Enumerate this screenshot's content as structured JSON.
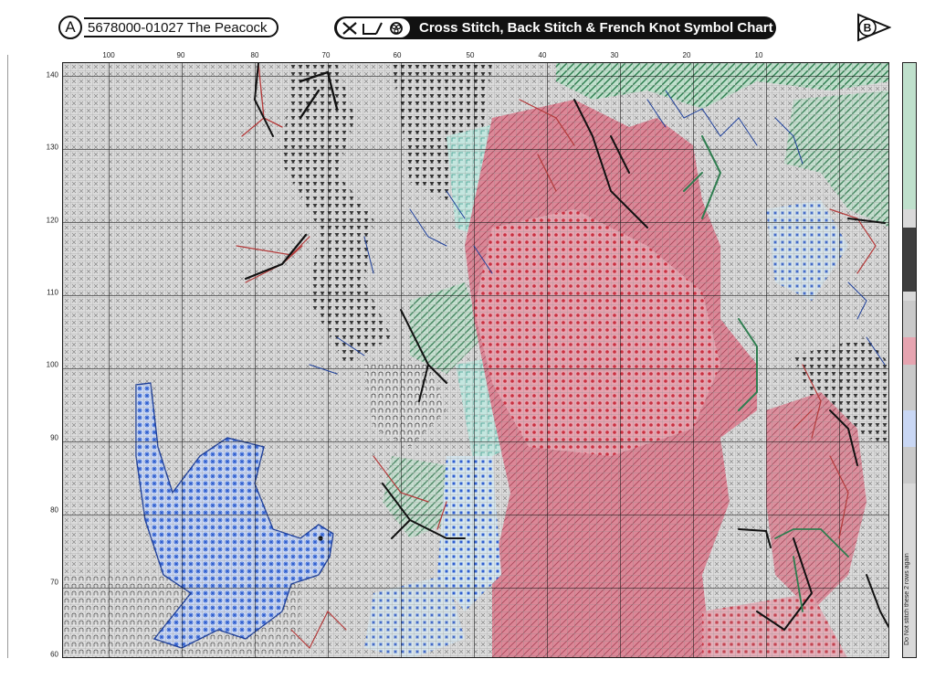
{
  "header": {
    "section_letter": "A",
    "pattern_title": "5678000-01027 The Peacock",
    "chart_title": "Cross Stitch, Back Stitch & French Knot Symbol Chart",
    "next_section_letter": "B"
  },
  "axes": {
    "columns": [
      "100",
      "90",
      "80",
      "70",
      "60",
      "50",
      "40",
      "30",
      "20",
      "10"
    ],
    "rows": [
      "140",
      "130",
      "120",
      "110",
      "100",
      "90",
      "80",
      "70",
      "60"
    ]
  },
  "side_note": "Do Not stitch these 2 rows again",
  "colors": {
    "grid_gray": "#d9d9d9",
    "floss_pink": "#e2889a",
    "floss_red": "#c92f3f",
    "floss_green": "#2e7d4f",
    "floss_blue": "#2f5fd0",
    "floss_black": "#111111",
    "floss_light_teal": "#a8d8d0"
  },
  "icons": [
    "cross-stitch-icon",
    "back-stitch-icon",
    "french-knot-icon",
    "arrow-right-icon",
    "down-arrow-marker-icon"
  ]
}
